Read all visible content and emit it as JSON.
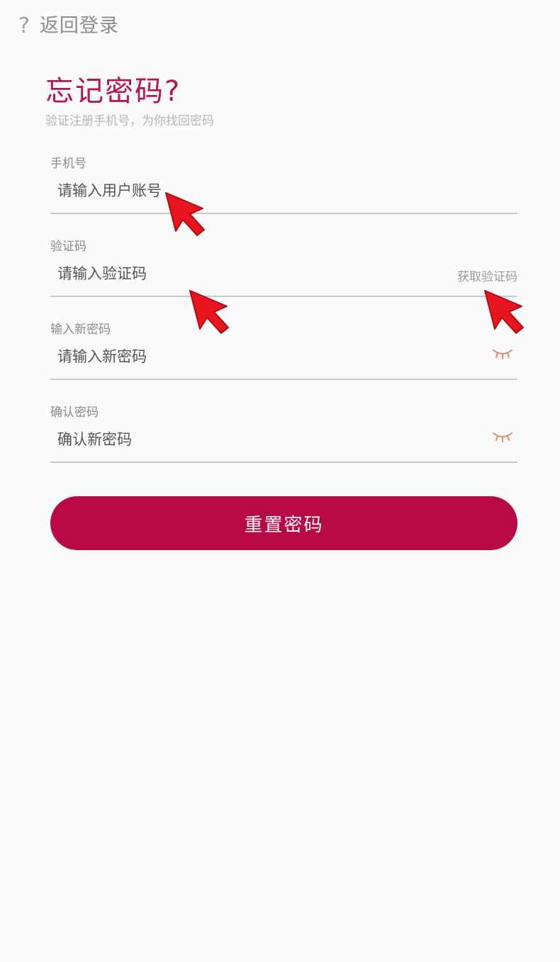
{
  "header": {
    "help_icon": "?",
    "back_label": "返回登录"
  },
  "title": "忘记密码?",
  "subtitle": "验证注册手机号，为你找回密码",
  "form": {
    "phone": {
      "label": "手机号",
      "placeholder": "请输入用户账号"
    },
    "code": {
      "label": "验证码",
      "placeholder": "请输入验证码",
      "get_code_label": "获取验证码"
    },
    "new_password": {
      "label": "输入新密码",
      "placeholder": "请输入新密码",
      "icon": "eye-closed-icon"
    },
    "confirm_password": {
      "label": "确认密码",
      "placeholder": "确认新密码",
      "icon": "eye-closed-icon"
    }
  },
  "submit_label": "重置密码",
  "colors": {
    "accent": "#b80942",
    "title": "#b8164a",
    "eye_icon": "#e0896a",
    "annotation": "#e8141e"
  }
}
